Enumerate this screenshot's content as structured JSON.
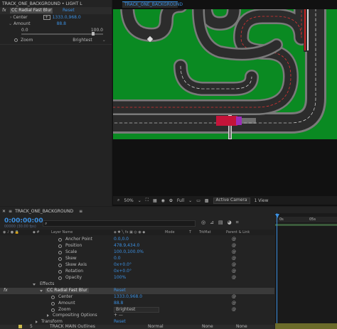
{
  "effect_controls": {
    "title": "TRACK_ONE_BACKGROUND • LIGHT L",
    "fx_label": "fx",
    "effect_name": "CC Radial Fast Blur",
    "reset": "Reset",
    "center_label": "Center",
    "center_value": "1333.0,968.0",
    "amount_label": "Amount",
    "amount_value": "88.8",
    "slider_min": "0.0",
    "slider_max": "100.0",
    "slider_level": 0.888,
    "zoom_label": "Zoom",
    "zoom_value": "Brightest"
  },
  "viewer": {
    "tab": "TRACK_ONE_BACKGROUND",
    "zoom": "50%",
    "resolution": "Full",
    "camera": "Active Camera",
    "views": "1 View"
  },
  "timeline": {
    "tab": "TRACK_ONE_BACKGROUND",
    "timecode": "0:00:00:00",
    "subtime": "00000 (30.00 fps)",
    "ruler_start": "0s",
    "ruler_mid": "05s",
    "columns": {
      "layer_name": "Layer Name",
      "mode": "Mode",
      "t": "T",
      "trkmat": "TrkMat",
      "parent": "Parent & Link"
    },
    "properties": [
      {
        "label": "Anchor Point",
        "value": "0.0,0.0"
      },
      {
        "label": "Position",
        "value": "478.9,434.0"
      },
      {
        "label": "Scale",
        "value": "100.0,100.0%"
      },
      {
        "label": "Skew",
        "value": "0.0"
      },
      {
        "label": "Skew Axis",
        "value": "0x+0.0°"
      },
      {
        "label": "Rotation",
        "value": "0x+0.0°"
      },
      {
        "label": "Opacity",
        "value": "100%"
      }
    ],
    "effects_label": "Effects",
    "effect_name": "CC Radial Fast Blur",
    "effect_reset": "Reset",
    "effect_props": [
      {
        "label": "Center",
        "value": "1333.0,968.0"
      },
      {
        "label": "Amount",
        "value": "88.8"
      },
      {
        "label": "Zoom",
        "value": "Brightest"
      }
    ],
    "compositing": "Compositing Options",
    "compositing_symbols": "+ —",
    "transform_label": "Transform",
    "transform_reset": "Reset",
    "last_layer_num": "5",
    "last_layer_name": "TRACK MAIN Outlines",
    "last_layer_mode": "Normal",
    "last_layer_trkmat": "None",
    "last_layer_parent": "None"
  }
}
